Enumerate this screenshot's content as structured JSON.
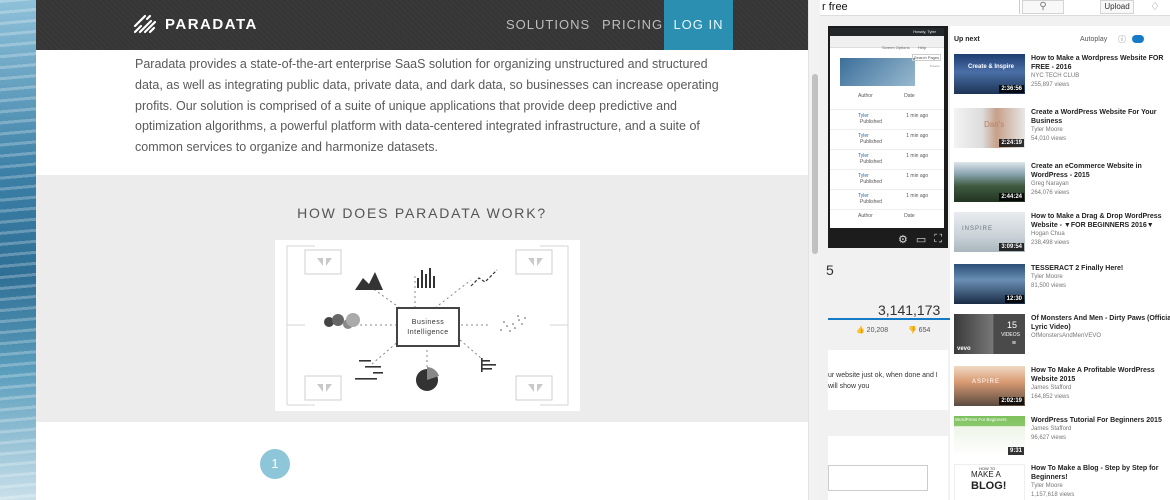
{
  "youtube": {
    "search_value": "r free",
    "upload_label": "Upload",
    "up_next_label": "Up next",
    "autoplay_label": "Autoplay",
    "view_count": "3,141,173",
    "likes": "20,208",
    "dislikes": "654",
    "partial_number": "5",
    "description_partial": "ur website just ok, when done and I will show you",
    "thumbnail_text": {
      "player_wp_user": "Howdy, Tyler",
      "player_screen_options": "Screen Options",
      "player_help": "Help",
      "player_search_pages": "Search Pages",
      "player_item_count": "5 items",
      "player_author_header": "Author",
      "player_date_header": "Date",
      "player_row_author": "Tyler",
      "player_row_date": "1 min ago",
      "player_row_status": "Published",
      "thumb1_banner": "Create & Inspire",
      "thumb2_badge": "Dan's",
      "thumb4_word": "INSPIRE",
      "thumb6_videos": "VIDEOS",
      "thumb6_vevo": "vevo",
      "thumb7_word": "ASPIRE",
      "thumb8_banner": "WordPress For Beginners",
      "thumb9_line1": "HOW TO",
      "thumb9_line2": "MAKE A",
      "thumb9_line3": "BLOG!"
    },
    "videos": [
      {
        "title": "How to Make a Wordpress Website FOR FREE - 2016",
        "channel": "NYC TECH CLUB",
        "views": "255,897 views",
        "duration": "2:36:56"
      },
      {
        "title": "Create a WordPress Website For Your Business",
        "channel": "Tyler Moore",
        "views": "54,010 views",
        "duration": "2:24:19"
      },
      {
        "title": "Create an eCommerce Website in WordPress - 2015",
        "channel": "Greg Narayan",
        "views": "264,076 views",
        "duration": "2:44:24"
      },
      {
        "title": "How to Make a Drag & Drop WordPress Website - ▼FOR BEGINNERS 2016▼",
        "channel": "Hogan Chua",
        "views": "238,498 views",
        "duration": "3:09:54"
      },
      {
        "title": "TESSERACT 2 Finally Here!",
        "channel": "Tyler Moore",
        "views": "81,500 views",
        "duration": "12:30"
      },
      {
        "title": "Of Monsters And Men - Dirty Paws (Official Lyric Video)",
        "channel": "OfMonstersAndMenVEVO",
        "views": "",
        "duration": "15"
      },
      {
        "title": "How To Make A Profitable WordPress Website 2015",
        "channel": "James Stafford",
        "views": "164,852 views",
        "duration": "2:02:19"
      },
      {
        "title": "WordPress Tutorial For Beginners 2015",
        "channel": "James Stafford",
        "views": "96,627 views",
        "duration": "9:31"
      },
      {
        "title": "How To Make a Blog - Step by Step for Beginners!",
        "channel": "Tyler Moore",
        "views": "1,157,618 views",
        "duration": ""
      }
    ]
  },
  "paradata": {
    "logo_text": "PARADATA",
    "nav": {
      "solutions": "SOLUTIONS",
      "pricing": "PRICING",
      "login": "LOG IN"
    },
    "intro": "Paradata provides a state-of-the-art enterprise SaaS solution for organizing unstructured and structured data, as well as integrating public data, private data, and dark data, so businesses can increase operating profits. Our solution is comprised of a suite of unique applications that provide deep predictive and optimization algorithms, a powerful platform with data-centered integrated infrastructure, and a suite of common services to organize and harmonize datasets.",
    "how_title": "HOW DOES PARADATA WORK?",
    "diagram_center_line1": "Business",
    "diagram_center_line2": "Intelligence",
    "step_number": "1"
  }
}
